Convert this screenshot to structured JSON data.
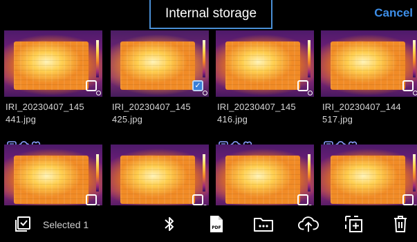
{
  "topbar": {
    "title": "Internal storage",
    "cancel_label": "Cancel"
  },
  "files": [
    {
      "name_line1": "IRI_20230407_145",
      "name_line2": "441.jpg",
      "selected": false,
      "badges": []
    },
    {
      "name_line1": "IRI_20230407_145",
      "name_line2": "425.jpg",
      "selected": true,
      "badges": []
    },
    {
      "name_line1": "IRI_20230407_145",
      "name_line2": "416.jpg",
      "selected": false,
      "badges": []
    },
    {
      "name_line1": "IRI_20230407_144",
      "name_line2": "517.jpg",
      "selected": false,
      "badges": []
    },
    {
      "name_line1": "",
      "name_line2": "",
      "selected": false,
      "badges": [
        "comment-icon",
        "cloud-upload-icon",
        "heart-icon"
      ]
    },
    {
      "name_line1": "",
      "name_line2": "",
      "selected": false,
      "badges": []
    },
    {
      "name_line1": "",
      "name_line2": "",
      "selected": false,
      "badges": [
        "comment-icon",
        "cloud-upload-icon",
        "heart-icon"
      ]
    },
    {
      "name_line1": "",
      "name_line2": "",
      "selected": false,
      "badges": [
        "comment-icon",
        "cloud-upload-icon",
        "heart-icon"
      ]
    }
  ],
  "bottombar": {
    "selected_label": "Selected 1",
    "tools": [
      "bluetooth-icon",
      "pdf-icon",
      "folder-more-icon",
      "cloud-upload-icon",
      "copy-add-icon",
      "trash-icon"
    ]
  },
  "colors": {
    "accent": "#3d8ee8",
    "badge": "#6a86ff",
    "title_border": "#4a8fd6"
  }
}
